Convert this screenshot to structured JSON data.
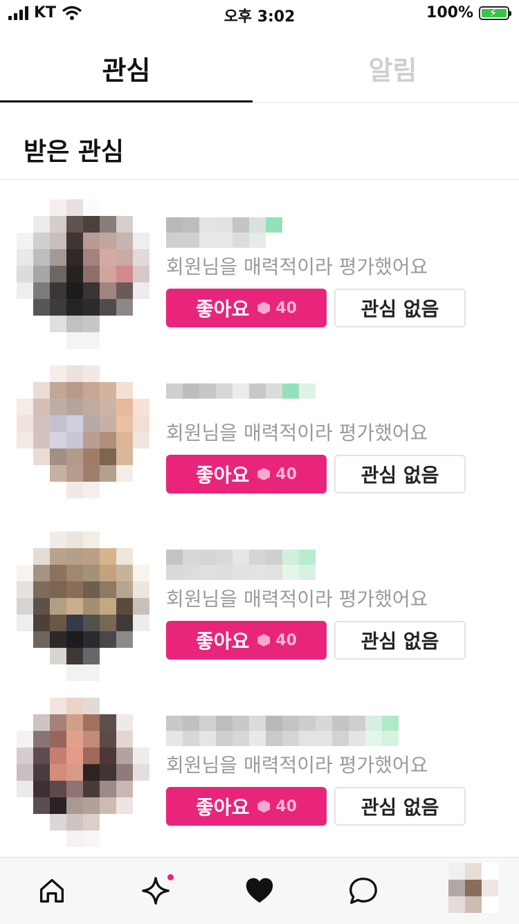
{
  "status_bar": {
    "carrier": "KT",
    "time": "오후 3:02",
    "battery": "100%",
    "battery_level": 1.0
  },
  "tabs": [
    {
      "label": "관심",
      "active": true
    },
    {
      "label": "알림",
      "active": false
    }
  ],
  "section_title": "받은 관심",
  "rows": [
    {
      "description": "회원님을 매력적이라 평가했어요",
      "like_label": "좋아요",
      "cost": "40",
      "pass_label": "관심 없음"
    },
    {
      "description": "회원님을 매력적이라 평가했어요",
      "like_label": "좋아요",
      "cost": "40",
      "pass_label": "관심 없음"
    },
    {
      "description": "회원님을 매력적이라 평가했어요",
      "like_label": "좋아요",
      "cost": "40",
      "pass_label": "관심 없음"
    },
    {
      "description": "회원님을 매력적이라 평가했어요",
      "like_label": "좋아요",
      "cost": "40",
      "pass_label": "관심 없음"
    }
  ],
  "bottom_nav": [
    {
      "icon": "home-icon"
    },
    {
      "icon": "sparkle-icon",
      "badge": true
    },
    {
      "icon": "heart-icon",
      "active": true
    },
    {
      "icon": "chat-bubble-icon"
    },
    {
      "icon": "profile-avatar"
    }
  ],
  "colors": {
    "accent": "#e8257a",
    "inactive_tab": "#cfcfcf",
    "description": "#9a9a9a"
  }
}
